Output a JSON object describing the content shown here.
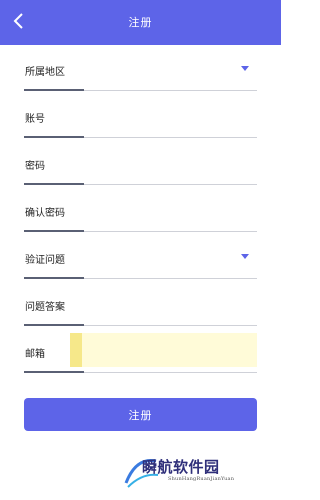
{
  "header": {
    "title": "注册",
    "back_icon": "chevron-left-icon"
  },
  "form": {
    "fields": [
      {
        "label": "所属地区",
        "type": "select"
      },
      {
        "label": "账号",
        "type": "text"
      },
      {
        "label": "密码",
        "type": "password"
      },
      {
        "label": "确认密码",
        "type": "password"
      },
      {
        "label": "验证问题",
        "type": "select"
      },
      {
        "label": "问题答案",
        "type": "text"
      },
      {
        "label": "邮箱",
        "type": "email"
      }
    ],
    "submit_label": "注册"
  },
  "watermark": {
    "title": "瞬航软件园",
    "subtitle": "ShunHangRuanJianYuan"
  },
  "colors": {
    "primary": "#5d64e8",
    "email_highlight": "#fffbd8"
  }
}
